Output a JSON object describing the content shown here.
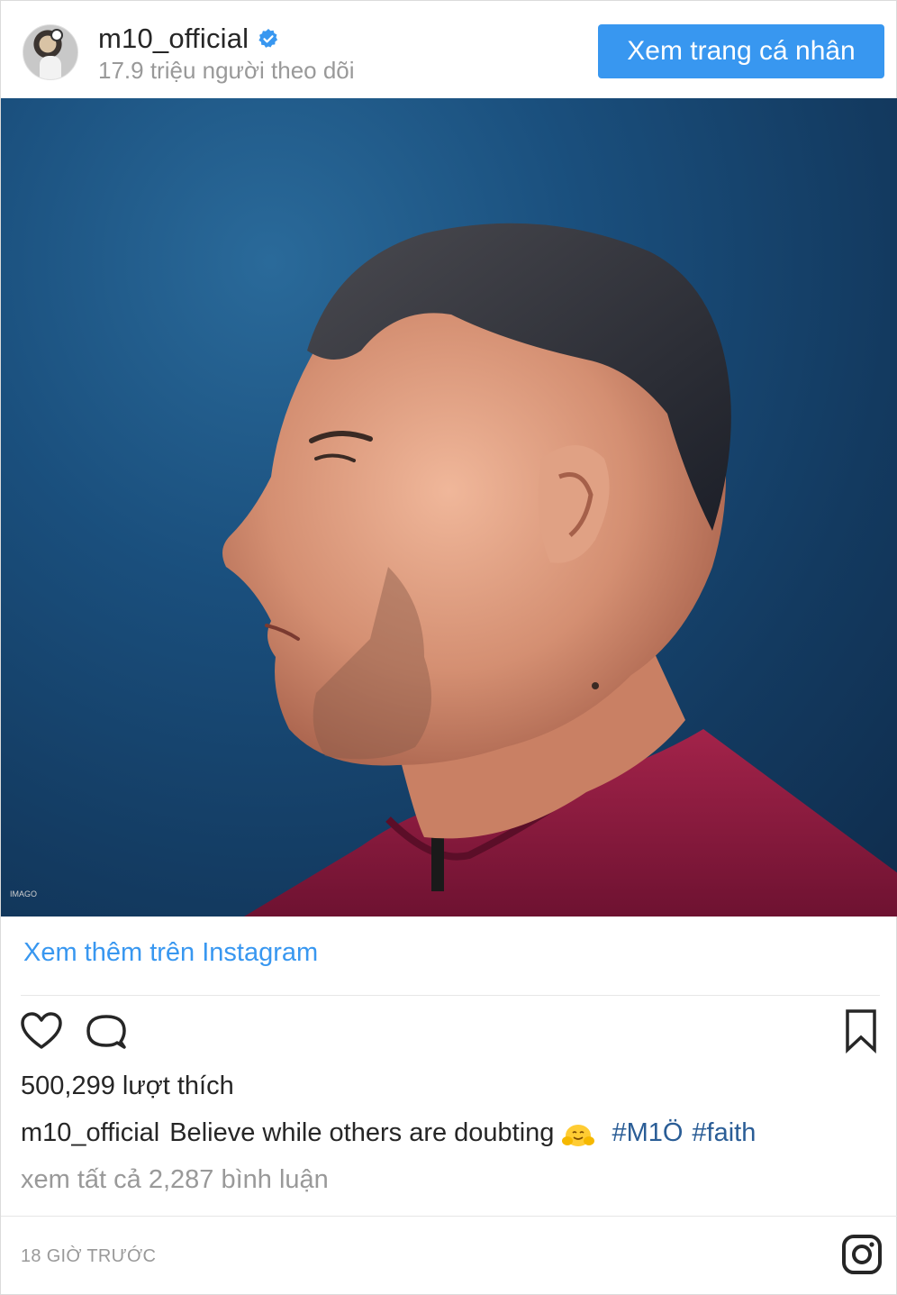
{
  "header": {
    "username": "m10_official",
    "followers": "17.9 triệu người theo dõi",
    "profile_button": "Xem trang cá nhân",
    "verified_icon": "verified-badge-icon"
  },
  "photo": {
    "watermark": "IMAGO"
  },
  "links": {
    "view_more": "Xem thêm trên Instagram"
  },
  "actions": {
    "like_icon": "heart-icon",
    "comment_icon": "comment-bubble-icon",
    "save_icon": "bookmark-icon"
  },
  "post": {
    "likes": "500,299 lượt thích",
    "caption_author": "m10_official",
    "caption_text": "Believe while others are doubting",
    "caption_emoji": "🤗",
    "hashtags": [
      "#M1Ö",
      "#faith"
    ],
    "view_comments": "xem tất cả 2,287 bình luận",
    "timestamp": "18 GIỜ TRƯỚC"
  },
  "colors": {
    "accent": "#3897f0",
    "text": "#262626",
    "muted": "#999999",
    "hashtag": "#2a5d96",
    "photo_bg": "#1a4f7d"
  }
}
